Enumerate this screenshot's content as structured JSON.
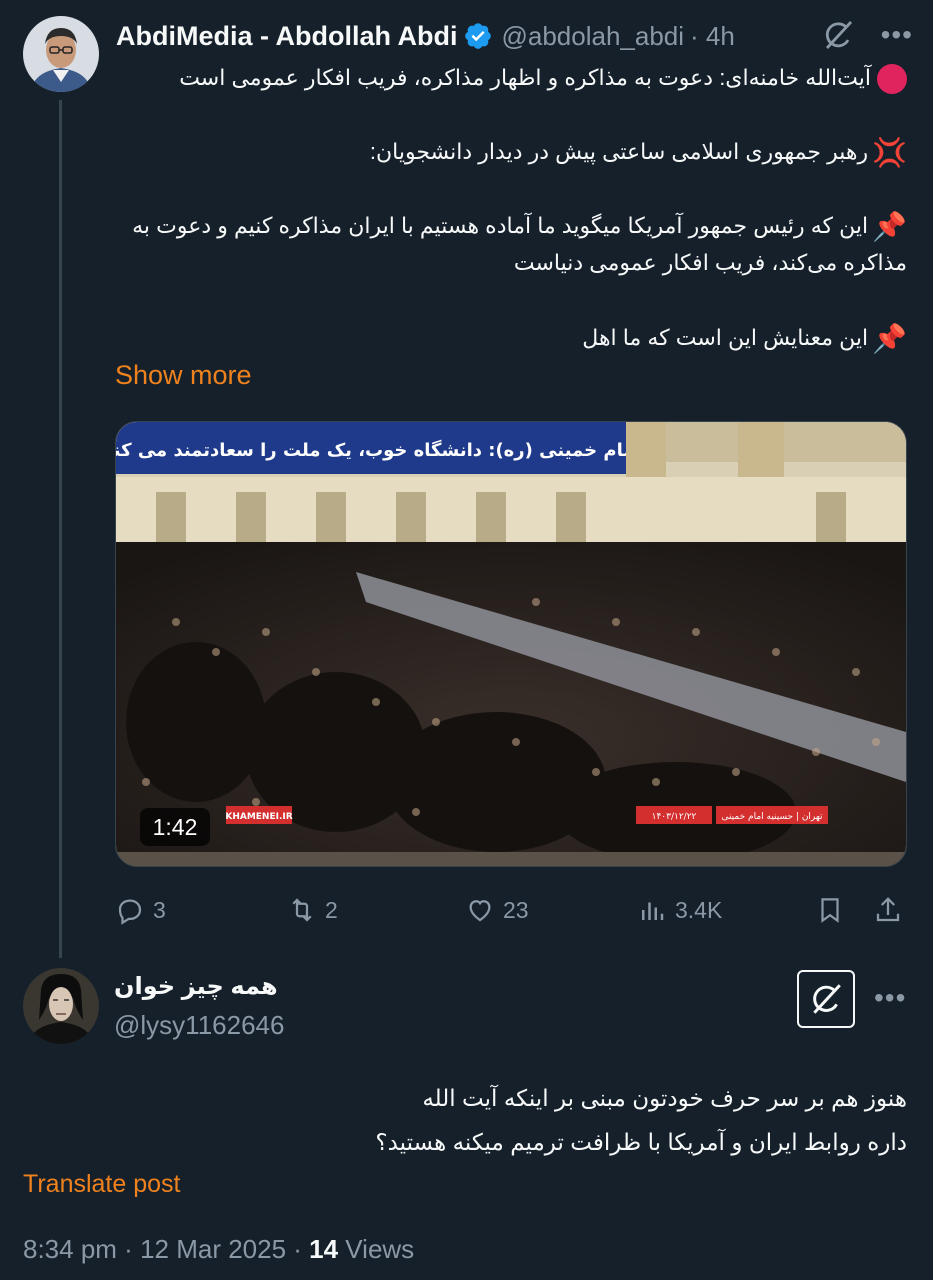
{
  "tweet": {
    "author_name": "AbdiMedia - Abdollah Abdi",
    "handle": "@abdolah_abdi",
    "time": "· 4h",
    "lines": [
      "آیت‌الله خامنه‌ای: دعوت به مذاکره و اظهار مذاکره، فریب افکار عمومی است",
      "رهبر جمهوری اسلامی ساعتی پیش در دیدار دانشجویان:",
      "این که رئیس جمهور آمریکا میگوید ما آماده هستیم با ایران مذاکره کنیم و دعوت به مذاکره می‌کند، فریب افکار عمومی دنیاست",
      "این معنایش این است که ما اهل"
    ],
    "show_more": "Show more",
    "media": {
      "banner_text": "امام خمینی (ره): دانشگاه خوب، یک ملت را سعادتمند می کند",
      "channel_logo": "KHAMENEI.IR",
      "location_caption": "تهران | حسینیه امام خمینی",
      "date_caption": "۱۴۰۳/۱۲/۲۲",
      "duration": "1:42"
    },
    "actions": {
      "replies": "3",
      "reposts": "2",
      "likes": "23",
      "views": "3.4K"
    },
    "icons": [
      "verified-icon",
      "grok-icon",
      "more-icon",
      "reply-icon",
      "repost-icon",
      "like-icon",
      "views-icon",
      "bookmark-icon",
      "share-icon"
    ],
    "colors": {
      "accent": "#f0821e",
      "verified": "#1d9bf0",
      "background": "#15202b",
      "muted": "#8b98a5"
    }
  },
  "reply": {
    "author_name": "همه چیز خوان",
    "handle": "@lysy1162646",
    "lines": [
      "هنوز هم بر سر حرف خودتون مبنی بر اینکه آیت الله",
      "داره روابط ایران و آمریکا با ظرافت ترمیم میکنه هستید؟"
    ],
    "translate": "Translate post",
    "meta": {
      "time": "8:34 pm",
      "sep1": " · ",
      "date": "12 Mar 2025",
      "sep2": " · ",
      "views_count": "14",
      "views_label": " Views"
    }
  }
}
